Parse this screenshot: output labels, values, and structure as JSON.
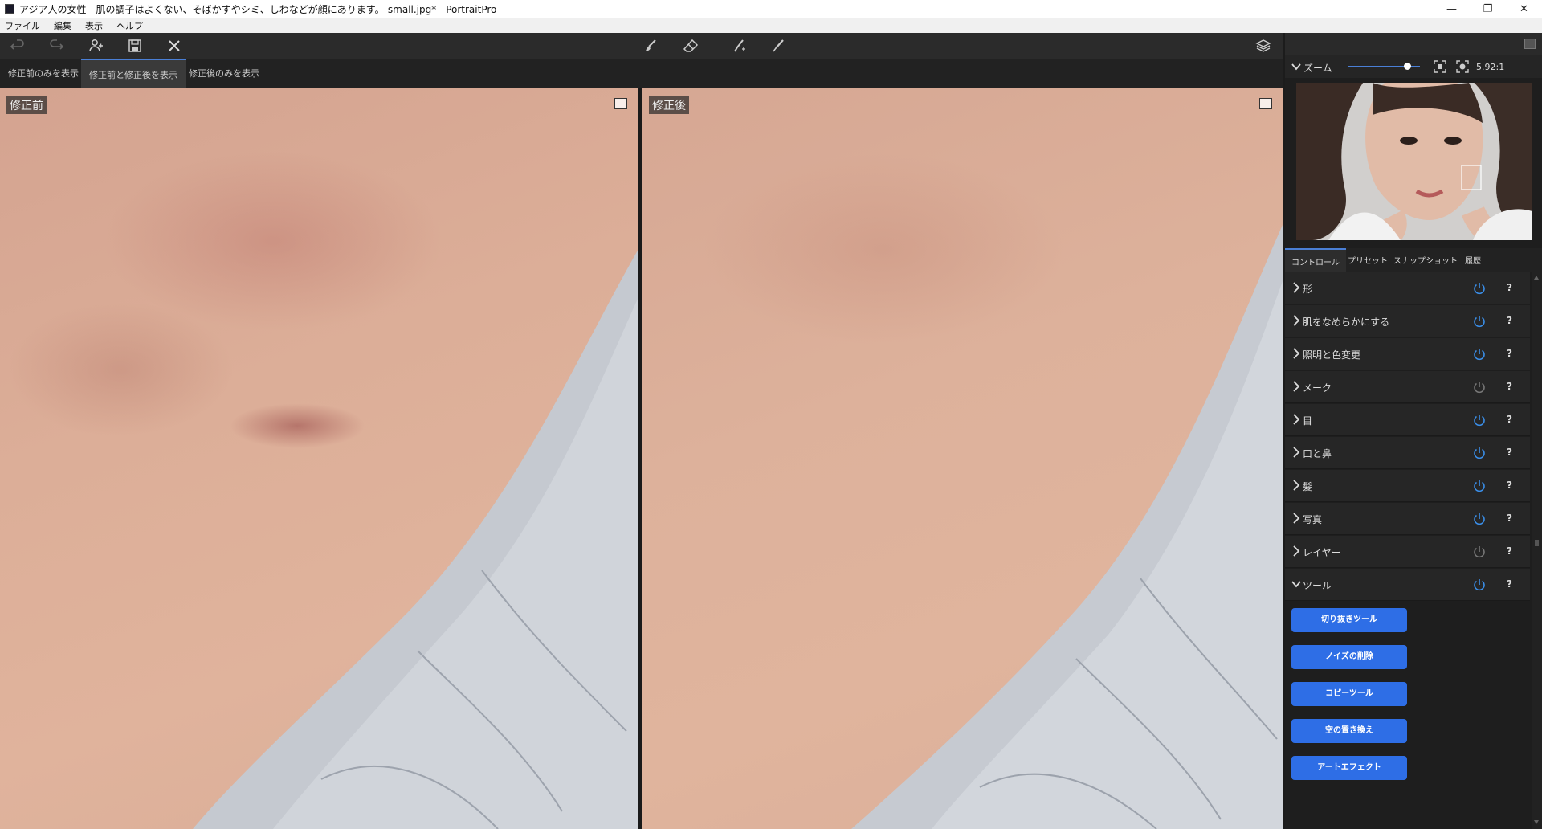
{
  "window": {
    "title": "アジア人の女性　肌の調子はよくない、そばかすやシミ、しわなどが顔にあります。-small.jpg* - PortraitPro",
    "controls": [
      "minimize-icon",
      "maximize-icon",
      "close-icon"
    ]
  },
  "menu": [
    "ファイル",
    "編集",
    "表示",
    "ヘルプ"
  ],
  "toolbar": {
    "left_icons": [
      "undo-icon",
      "redo-icon",
      "add-person-icon",
      "save-icon",
      "close-icon"
    ],
    "center_icons": [
      "brush-icon",
      "eraser-icon",
      "restore-brush-icon",
      "pen-icon"
    ],
    "right_icon": "layers-icon"
  },
  "view_tabs": [
    "修正前のみを表示",
    "修正前と修正後を表示",
    "修正後のみを表示"
  ],
  "view_tabs_active": 1,
  "panes": {
    "before_label": "修正前",
    "after_label": "修正後"
  },
  "zoom": {
    "label": "ズーム",
    "value": "5.92:1",
    "slider_level": 0.82
  },
  "control_tabs": [
    "コントロール",
    "プリセット",
    "スナップショット",
    "履歴"
  ],
  "control_tabs_active": 0,
  "controls": [
    {
      "label": "形",
      "enabled": true
    },
    {
      "label": "肌をなめらかにする",
      "enabled": true
    },
    {
      "label": "照明と色変更",
      "enabled": true
    },
    {
      "label": "メーク",
      "enabled": false
    },
    {
      "label": "目",
      "enabled": true
    },
    {
      "label": "口と鼻",
      "enabled": true
    },
    {
      "label": "髪",
      "enabled": true
    },
    {
      "label": "写真",
      "enabled": true
    },
    {
      "label": "レイヤー",
      "enabled": false
    },
    {
      "label": "ツール",
      "enabled": true,
      "expanded": true
    }
  ],
  "help_label": "?",
  "tool_buttons": [
    "切り抜きツール",
    "ノイズの削除",
    "コピーツール",
    "空の置き換え",
    "アートエフェクト"
  ],
  "colors": {
    "accent": "#2e6ee6",
    "power_on": "#3a8ee8",
    "power_off": "#777777"
  }
}
